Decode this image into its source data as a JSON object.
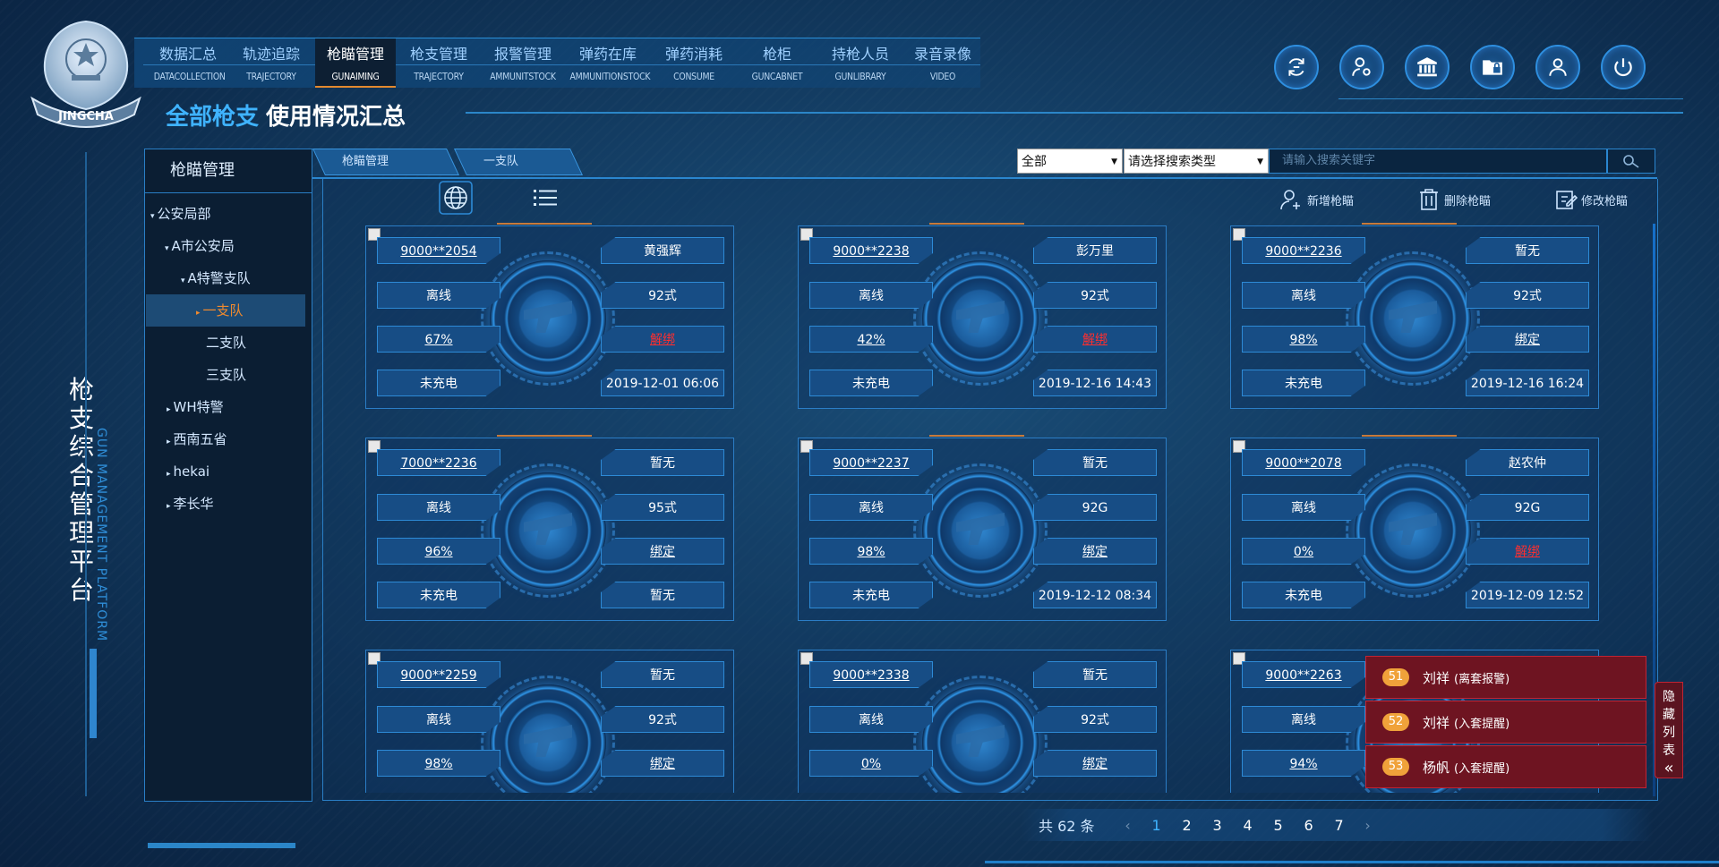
{
  "emblem_text": "JINGCHA",
  "nav": [
    {
      "cn": "数据汇总",
      "en": "DATACOLLECTION"
    },
    {
      "cn": "轨迹追踪",
      "en": "TRAJECTORY"
    },
    {
      "cn": "枪瞄管理",
      "en": "GUNAIMING",
      "active": true
    },
    {
      "cn": "枪支管理",
      "en": "TRAJECTORY"
    },
    {
      "cn": "报警管理",
      "en": "AMMUNITSTOCK"
    },
    {
      "cn": "弹药在库",
      "en": "AMMUNITIONSTOCK"
    },
    {
      "cn": "弹药消耗",
      "en": "CONSUME"
    },
    {
      "cn": "枪柜",
      "en": "GUNCABNET"
    },
    {
      "cn": "持枪人员",
      "en": "GUNLIBRARY"
    },
    {
      "cn": "录音录像",
      "en": "VIDEO"
    }
  ],
  "page_title": {
    "a": "全部枪支",
    "b": "使用情况汇总"
  },
  "top_icons": [
    "sync-icon",
    "user-settings-icon",
    "bank-icon",
    "folder-lock-icon",
    "user-icon",
    "power-icon"
  ],
  "side_brand": {
    "cn": "枪支综合管理平台",
    "en": "GUN MANAGEMENT PLATFORM"
  },
  "tree": {
    "title": "枪瞄管理",
    "items": [
      {
        "label": "公安局部",
        "level": 0,
        "arrow": "▾"
      },
      {
        "label": "A市公安局",
        "level": 1,
        "arrow": "▾"
      },
      {
        "label": "A特警支队",
        "level": 2,
        "arrow": "▾"
      },
      {
        "label": "一支队",
        "level": 3,
        "arrow": "▸",
        "active": true
      },
      {
        "label": "二支队",
        "level": 3,
        "arrow": ""
      },
      {
        "label": "三支队",
        "level": 3,
        "arrow": ""
      },
      {
        "label": "WH特警",
        "level": 1,
        "arrow": "▸"
      },
      {
        "label": "西南五省",
        "level": 1,
        "arrow": "▸"
      },
      {
        "label": "hekai",
        "level": 1,
        "arrow": "▸"
      },
      {
        "label": "李长华",
        "level": 1,
        "arrow": "▸"
      }
    ]
  },
  "breadcrumb": [
    "枪瞄管理",
    "一支队"
  ],
  "search": {
    "scope": "全部",
    "type_placeholder": "请选择搜索类型",
    "keyword_placeholder": "请输入搜索关键字"
  },
  "actions": {
    "add": "新增枪瞄",
    "delete": "删除枪瞄",
    "edit": "修改枪瞄"
  },
  "cards": [
    {
      "id": "9000**2054",
      "holder": "黄强辉",
      "status": "离线",
      "model": "92式",
      "battery": "67%",
      "bind": "解绑",
      "bind_red": true,
      "charge": "未充电",
      "time": "2019-12-01 06:06"
    },
    {
      "id": "9000**2238",
      "holder": "彭万里",
      "status": "离线",
      "model": "92式",
      "battery": "42%",
      "bind": "解绑",
      "bind_red": true,
      "charge": "未充电",
      "time": "2019-12-16 14:43"
    },
    {
      "id": "9000**2236",
      "holder": "暂无",
      "status": "离线",
      "model": "92式",
      "battery": "98%",
      "bind": "绑定",
      "bind_red": false,
      "charge": "未充电",
      "time": "2019-12-16 16:24"
    },
    {
      "id": "7000**2236",
      "holder": "暂无",
      "status": "离线",
      "model": "95式",
      "battery": "96%",
      "bind": "绑定",
      "bind_red": false,
      "charge": "未充电",
      "time": "暂无"
    },
    {
      "id": "9000**2237",
      "holder": "暂无",
      "status": "离线",
      "model": "92G",
      "battery": "98%",
      "bind": "绑定",
      "bind_red": false,
      "charge": "未充电",
      "time": "2019-12-12 08:34"
    },
    {
      "id": "9000**2078",
      "holder": "赵农仲",
      "status": "离线",
      "model": "92G",
      "battery": "0%",
      "bind": "解绑",
      "bind_red": true,
      "charge": "未充电",
      "time": "2019-12-09 12:52"
    },
    {
      "id": "9000**2259",
      "holder": "暂无",
      "status": "离线",
      "model": "92式",
      "battery": "98%",
      "bind": "绑定",
      "bind_red": false,
      "charge": "",
      "time": ""
    },
    {
      "id": "9000**2338",
      "holder": "暂无",
      "status": "离线",
      "model": "92式",
      "battery": "0%",
      "bind": "绑定",
      "bind_red": false,
      "charge": "",
      "time": ""
    },
    {
      "id": "9000**2263",
      "holder": "",
      "status": "离线",
      "model": "",
      "battery": "94%",
      "bind": "",
      "bind_red": false,
      "charge": "",
      "time": ""
    }
  ],
  "alerts": [
    {
      "num": "51",
      "name": "刘祥",
      "note": "(离套报警)"
    },
    {
      "num": "52",
      "name": "刘祥",
      "note": "(入套提醒)"
    },
    {
      "num": "53",
      "name": "杨帆",
      "note": "(入套提醒)"
    }
  ],
  "hide_list_label": "隐藏列表",
  "hide_list_chars": [
    "隐",
    "藏",
    "列",
    "表"
  ],
  "pagination": {
    "total": "共 62 条",
    "pages": [
      "1",
      "2",
      "3",
      "4",
      "5",
      "6",
      "7"
    ],
    "current": "1",
    "prev": "‹",
    "next": "›"
  },
  "colors": {
    "accent": "#3fb3ff",
    "active_tab_underline": "#e3892e",
    "tree_active": "#f08a2e",
    "unbind_red": "#ff2e2e",
    "alert_bg": "#6e1421",
    "badge": "#f0a23a"
  }
}
